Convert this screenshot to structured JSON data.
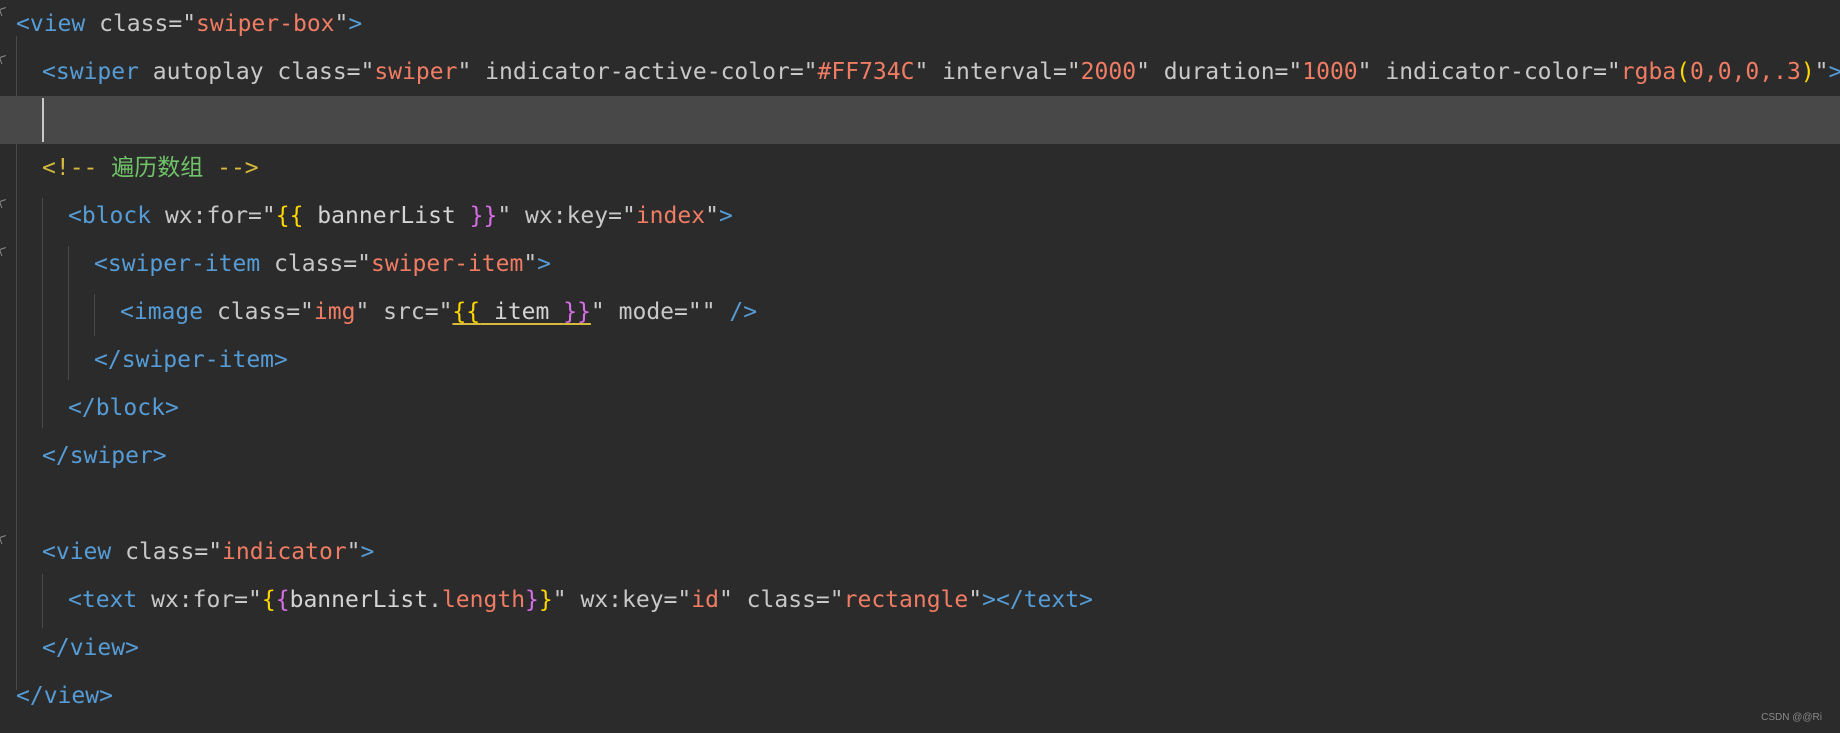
{
  "editor": {
    "language": "wxml",
    "theme": "dark",
    "colors": {
      "background": "#2b2b2b",
      "active_line": "#484848",
      "tag": "#569cd6",
      "attribute": "#c8c8c8",
      "string": "#f07c64",
      "comment": "#6fc267",
      "brace_outer": "#ffd700",
      "brace_inner": "#d86ee8"
    },
    "lines": [
      {
        "tokens": [
          "<",
          "view",
          " class=",
          "\"",
          "swiper-box",
          "\"",
          ">"
        ]
      },
      {
        "tokens": [
          "<",
          "swiper",
          " autoplay class=",
          "\"",
          "swiper",
          "\"",
          " indicator-active-color=",
          "\"",
          "#FF734C",
          "\"",
          " interval=",
          "\"",
          "2000",
          "\"",
          " duration=",
          "\"",
          "1000",
          "\"",
          " indicator-color=",
          "\"",
          "rgba",
          "(",
          "0,0,0,.3",
          ")",
          "\"",
          ">"
        ]
      },
      {
        "tokens": []
      },
      {
        "tokens": [
          "<!--",
          " 遍历数组 ",
          "-->"
        ]
      },
      {
        "tokens": [
          "<",
          "block",
          " wx:for=",
          "\"",
          "{{",
          " bannerList ",
          "}}",
          "\"",
          " wx:key=",
          "\"",
          "index",
          "\"",
          ">"
        ]
      },
      {
        "tokens": [
          "<",
          "swiper-item",
          " class=",
          "\"",
          "swiper-item",
          "\"",
          ">"
        ]
      },
      {
        "tokens": [
          "<",
          "image",
          " class=",
          "\"",
          "img",
          "\"",
          " src=",
          "\"",
          "{{",
          " item ",
          "}}",
          "\"",
          " mode=",
          "\"\"",
          " />"
        ]
      },
      {
        "tokens": [
          "</",
          "swiper-item",
          ">"
        ]
      },
      {
        "tokens": [
          "</",
          "block",
          ">"
        ]
      },
      {
        "tokens": [
          "</",
          "swiper",
          ">"
        ]
      },
      {
        "tokens": []
      },
      {
        "tokens": [
          "<",
          "view",
          " class=",
          "\"",
          "indicator",
          "\"",
          ">"
        ]
      },
      {
        "tokens": [
          "<",
          "text",
          " wx:for=",
          "\"",
          "{",
          "{",
          "bannerList",
          ".",
          "length",
          "}",
          "}",
          "\"",
          " wx:key=",
          "\"",
          "id",
          "\"",
          " class=",
          "\"",
          "rectangle",
          "\"",
          ">",
          "</",
          "text",
          ">"
        ]
      },
      {
        "tokens": [
          "</",
          "view",
          ">"
        ]
      },
      {
        "tokens": [
          "</",
          "view",
          ">"
        ]
      }
    ]
  },
  "watermark": "CSDN @@Ri"
}
